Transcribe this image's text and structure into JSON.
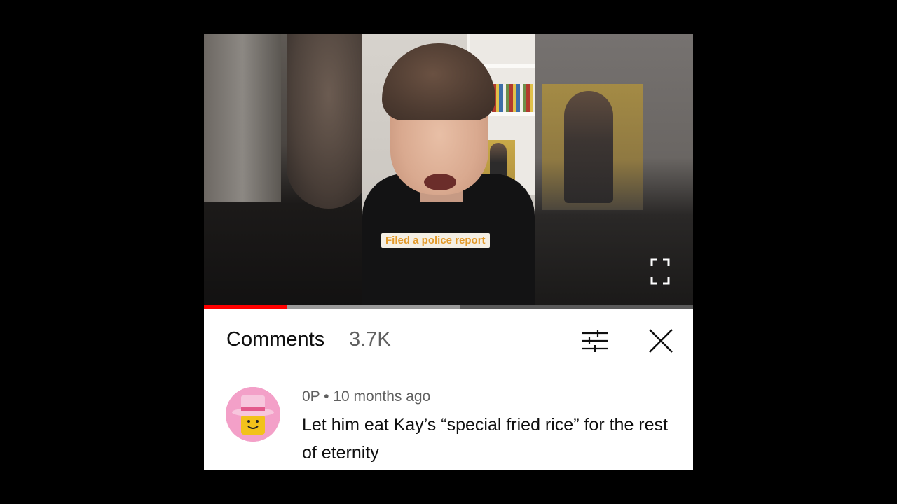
{
  "video": {
    "caption": "Filed a police report",
    "progress": {
      "played_fraction": 0.17,
      "buffered_fraction": 0.525
    }
  },
  "comments_panel": {
    "title": "Comments",
    "count": "3.7K"
  },
  "comment": {
    "author": "0P",
    "separator": "•",
    "time_ago": "10 months ago",
    "text": "Let him eat Kay’s “special fried rice” for the rest of eternity"
  },
  "colors": {
    "progress_played": "#ff0000",
    "avatar_background": "#f3a0c8",
    "caption_text": "#e39a2a"
  },
  "icons": {
    "fullscreen": "fullscreen-icon",
    "sort": "sort-filter-icon",
    "close": "close-icon"
  }
}
